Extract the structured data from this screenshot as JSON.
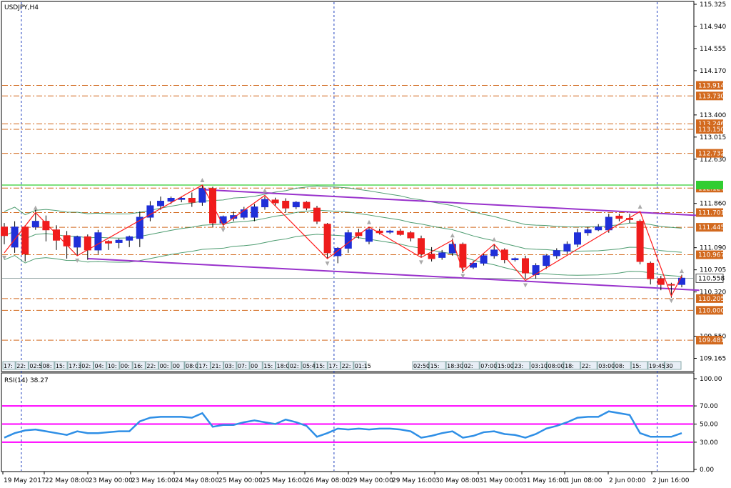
{
  "window": {
    "title": "USDJPY,H4",
    "rsi_label": "RSI(14) 38.27"
  },
  "colors": {
    "bull_candle": "#1f2fd8",
    "bear_candle": "#ee1c1c",
    "sr_line": "#d2691e",
    "trend_channel": "#9932cc",
    "zigzag": "#ff1a1a",
    "ma_line": "#2e8b57",
    "rsi_line": "#2f8fe6",
    "rsi_level": "#ff00ff",
    "period_sep": "#1f3fbf",
    "green_level": "#32cd32",
    "grid": "#000000"
  },
  "chart_data": [
    {
      "type": "candlestick",
      "symbol": "USDJPY",
      "timeframe": "H4",
      "x_axis_labels": [
        "19 May 2017",
        "22 May 08:00",
        "23 May 00:00",
        "23 May 16:00",
        "24 May 08:00",
        "25 May 00:00",
        "25 May 16:00",
        "26 May 08:00",
        "29 May 00:00",
        "29 May 16:00",
        "30 May 08:00",
        "31 May 00:00",
        "31 May 16:00",
        "1 Jun 08:00",
        "2 Jun 00:00",
        "2 Jun 16:00"
      ],
      "y_axis_labels": [
        "115.325",
        "114.940",
        "114.555",
        "114.170",
        "113.400",
        "113.015",
        "112.630",
        "111.860",
        "111.090",
        "110.705",
        "110.320",
        "109.550",
        "109.165"
      ],
      "ylim": [
        108.96,
        115.35
      ],
      "level_tags": [
        "113.914",
        "113.730",
        "113.246",
        "113.150",
        "112.732",
        "112.127",
        "111.701",
        "111.445",
        "110.967",
        "110.205",
        "110.000",
        "109.481"
      ],
      "current_price": "110.558",
      "candles": [
        {
          "o": 111.45,
          "h": 111.52,
          "c": 111.3,
          "l": 111.15
        },
        {
          "o": 111.1,
          "h": 111.55,
          "c": 111.45,
          "l": 111.0
        },
        {
          "o": 111.45,
          "h": 111.48,
          "c": 110.98,
          "l": 110.85
        },
        {
          "o": 111.45,
          "h": 111.75,
          "c": 111.55,
          "l": 111.4
        },
        {
          "o": 111.55,
          "h": 111.65,
          "c": 111.4,
          "l": 111.2
        },
        {
          "o": 111.4,
          "h": 111.48,
          "c": 111.22,
          "l": 111.05
        },
        {
          "o": 111.3,
          "h": 111.38,
          "c": 111.12,
          "l": 110.9
        },
        {
          "o": 111.1,
          "h": 111.3,
          "c": 111.28,
          "l": 110.95
        },
        {
          "o": 111.28,
          "h": 111.32,
          "c": 111.05,
          "l": 110.88
        },
        {
          "o": 111.05,
          "h": 111.4,
          "c": 111.35,
          "l": 110.98
        },
        {
          "o": 111.2,
          "h": 111.22,
          "c": 111.17,
          "l": 111.05
        },
        {
          "o": 111.18,
          "h": 111.25,
          "c": 111.22,
          "l": 111.08
        },
        {
          "o": 111.22,
          "h": 111.3,
          "c": 111.28,
          "l": 111.1
        },
        {
          "o": 111.25,
          "h": 111.72,
          "c": 111.62,
          "l": 111.1
        },
        {
          "o": 111.62,
          "h": 111.9,
          "c": 111.82,
          "l": 111.55
        },
        {
          "o": 111.82,
          "h": 111.98,
          "c": 111.9,
          "l": 111.75
        },
        {
          "o": 111.9,
          "h": 111.98,
          "c": 111.95,
          "l": 111.85
        },
        {
          "o": 111.93,
          "h": 111.98,
          "c": 111.95,
          "l": 111.88
        },
        {
          "o": 111.95,
          "h": 112.05,
          "c": 111.88,
          "l": 111.8
        },
        {
          "o": 111.88,
          "h": 112.18,
          "c": 112.12,
          "l": 111.82
        },
        {
          "o": 112.12,
          "h": 112.15,
          "c": 111.52,
          "l": 111.45
        },
        {
          "o": 111.52,
          "h": 111.65,
          "c": 111.63,
          "l": 111.45
        },
        {
          "o": 111.6,
          "h": 111.72,
          "c": 111.65,
          "l": 111.55
        },
        {
          "o": 111.62,
          "h": 111.8,
          "c": 111.75,
          "l": 111.58
        },
        {
          "o": 111.62,
          "h": 111.85,
          "c": 111.8,
          "l": 111.55
        },
        {
          "o": 111.8,
          "h": 111.98,
          "c": 111.93,
          "l": 111.75
        },
        {
          "o": 111.92,
          "h": 111.96,
          "c": 111.87,
          "l": 111.82
        },
        {
          "o": 111.9,
          "h": 111.95,
          "c": 111.78,
          "l": 111.7
        },
        {
          "o": 111.8,
          "h": 111.9,
          "c": 111.88,
          "l": 111.76
        },
        {
          "o": 111.88,
          "h": 111.9,
          "c": 111.78,
          "l": 111.74
        },
        {
          "o": 111.78,
          "h": 111.82,
          "c": 111.55,
          "l": 111.5
        },
        {
          "o": 111.5,
          "h": 111.52,
          "c": 111.0,
          "l": 110.9
        },
        {
          "o": 110.95,
          "h": 111.1,
          "c": 111.08,
          "l": 110.82
        },
        {
          "o": 111.08,
          "h": 111.4,
          "c": 111.35,
          "l": 111.0
        },
        {
          "o": 111.35,
          "h": 111.42,
          "c": 111.3,
          "l": 111.25
        },
        {
          "o": 111.2,
          "h": 111.45,
          "c": 111.4,
          "l": 111.15
        },
        {
          "o": 111.38,
          "h": 111.42,
          "c": 111.35,
          "l": 111.32
        },
        {
          "o": 111.36,
          "h": 111.4,
          "c": 111.38,
          "l": 111.33
        },
        {
          "o": 111.38,
          "h": 111.42,
          "c": 111.32,
          "l": 111.3
        },
        {
          "o": 111.35,
          "h": 111.38,
          "c": 111.26,
          "l": 111.2
        },
        {
          "o": 111.25,
          "h": 111.3,
          "c": 110.98,
          "l": 110.92
        },
        {
          "o": 110.98,
          "h": 111.1,
          "c": 110.9,
          "l": 110.85
        },
        {
          "o": 110.92,
          "h": 111.05,
          "c": 111.0,
          "l": 110.88
        },
        {
          "o": 111.0,
          "h": 111.25,
          "c": 111.15,
          "l": 110.95
        },
        {
          "o": 111.15,
          "h": 111.18,
          "c": 110.75,
          "l": 110.65
        },
        {
          "o": 110.75,
          "h": 110.86,
          "c": 110.82,
          "l": 110.72
        },
        {
          "o": 110.82,
          "h": 110.98,
          "c": 110.95,
          "l": 110.78
        },
        {
          "o": 110.95,
          "h": 111.15,
          "c": 111.05,
          "l": 110.9
        },
        {
          "o": 111.05,
          "h": 111.08,
          "c": 110.88,
          "l": 110.82
        },
        {
          "o": 110.88,
          "h": 110.92,
          "c": 110.9,
          "l": 110.85
        },
        {
          "o": 110.9,
          "h": 110.95,
          "c": 110.65,
          "l": 110.55
        },
        {
          "o": 110.62,
          "h": 110.82,
          "c": 110.78,
          "l": 110.55
        },
        {
          "o": 110.78,
          "h": 110.98,
          "c": 110.95,
          "l": 110.72
        },
        {
          "o": 110.95,
          "h": 111.08,
          "c": 111.04,
          "l": 110.9
        },
        {
          "o": 111.03,
          "h": 111.2,
          "c": 111.15,
          "l": 110.98
        },
        {
          "o": 111.15,
          "h": 111.42,
          "c": 111.35,
          "l": 111.1
        },
        {
          "o": 111.35,
          "h": 111.45,
          "c": 111.4,
          "l": 111.3
        },
        {
          "o": 111.4,
          "h": 111.5,
          "c": 111.45,
          "l": 111.38
        },
        {
          "o": 111.4,
          "h": 111.68,
          "c": 111.62,
          "l": 111.35
        },
        {
          "o": 111.64,
          "h": 111.68,
          "c": 111.6,
          "l": 111.55
        },
        {
          "o": 111.6,
          "h": 111.68,
          "c": 111.58,
          "l": 111.52
        },
        {
          "o": 111.55,
          "h": 111.58,
          "c": 110.85,
          "l": 110.8
        },
        {
          "o": 110.82,
          "h": 110.85,
          "c": 110.55,
          "l": 110.45
        },
        {
          "o": 110.55,
          "h": 110.6,
          "c": 110.45,
          "l": 110.35
        },
        {
          "o": 110.45,
          "h": 110.48,
          "c": 110.44,
          "l": 110.22
        },
        {
          "o": 110.45,
          "h": 110.62,
          "c": 110.56,
          "l": 110.4
        }
      ],
      "zigzag": [
        [
          0,
          111.0
        ],
        [
          3,
          111.7
        ],
        [
          7,
          110.95
        ],
        [
          19,
          112.18
        ],
        [
          21,
          111.48
        ],
        [
          25,
          112.0
        ],
        [
          31,
          110.9
        ],
        [
          35,
          111.45
        ],
        [
          40,
          110.92
        ],
        [
          43,
          111.22
        ],
        [
          44,
          110.68
        ],
        [
          47,
          111.15
        ],
        [
          50,
          110.52
        ],
        [
          61,
          111.72
        ],
        [
          64,
          110.25
        ],
        [
          65,
          110.6
        ]
      ],
      "trend_channel": {
        "upper": [
          [
            19,
            112.1
          ],
          [
            66,
            111.65
          ]
        ],
        "lower": [
          [
            8,
            110.9
          ],
          [
            66,
            110.35
          ]
        ]
      },
      "green_level": 112.18
    },
    {
      "type": "line",
      "indicator": "RSI(14)",
      "y_axis_labels": [
        "100.00",
        "70.00",
        "50.00",
        "30.00",
        "0.00"
      ],
      "ylim": [
        0,
        100
      ],
      "levels": [
        70,
        50,
        30
      ],
      "series": [
        {
          "values": [
            35,
            40,
            43,
            44,
            42,
            40,
            38,
            42,
            40,
            40,
            41,
            42,
            42,
            53,
            57,
            58,
            58,
            58,
            57,
            62,
            47,
            49,
            49,
            52,
            54,
            52,
            50,
            55,
            52,
            48,
            36,
            40,
            45,
            44,
            45,
            44,
            45,
            45,
            44,
            42,
            35,
            37,
            40,
            42,
            35,
            37,
            41,
            42,
            39,
            38,
            35,
            39,
            45,
            48,
            52,
            57,
            58,
            58,
            64,
            62,
            60,
            40,
            36,
            36,
            36,
            40
          ]
        }
      ]
    }
  ],
  "time_markers": {
    "left": [
      "17:",
      "22:",
      "02:50",
      "08:",
      "15:",
      "17:30",
      "02:",
      "04:",
      "10:",
      "00:",
      "16:",
      "22:",
      "00:",
      "00",
      "08:00",
      "17:",
      "21:",
      "03:",
      "07:",
      "00",
      "15:",
      "18:00",
      "02:",
      "05:45",
      "15:",
      "17:",
      "22:",
      "01:15"
    ],
    "right": [
      "02:50",
      "15:",
      "18:30",
      "02:",
      "07:00",
      "15:00",
      "23:",
      "03:10",
      "08:00",
      "18:",
      "22:",
      "03:00",
      "08:",
      "15:",
      "19:45",
      "30"
    ]
  }
}
